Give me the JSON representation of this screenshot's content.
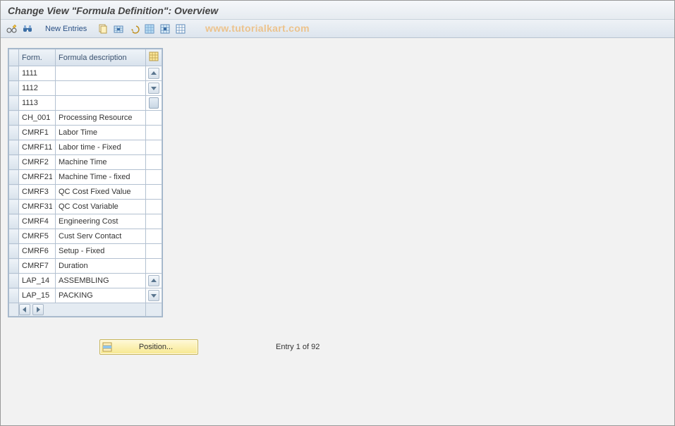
{
  "title": "Change View \"Formula Definition\": Overview",
  "watermark": "www.tutorialkart.com",
  "toolbar": {
    "new_entries_label": "New Entries"
  },
  "grid": {
    "headers": {
      "form": "Form.",
      "desc": "Formula description"
    },
    "rows": [
      {
        "form": "1111",
        "desc": ""
      },
      {
        "form": "1112",
        "desc": ""
      },
      {
        "form": "1113",
        "desc": ""
      },
      {
        "form": "CH_001",
        "desc": "Processing Resource"
      },
      {
        "form": "CMRF1",
        "desc": "Labor Time"
      },
      {
        "form": "CMRF11",
        "desc": "Labor time - Fixed"
      },
      {
        "form": "CMRF2",
        "desc": "Machine Time"
      },
      {
        "form": "CMRF21",
        "desc": "Machine Time - fixed"
      },
      {
        "form": "CMRF3",
        "desc": "QC Cost Fixed Value"
      },
      {
        "form": "CMRF31",
        "desc": "QC Cost Variable"
      },
      {
        "form": "CMRF4",
        "desc": "Engineering Cost"
      },
      {
        "form": "CMRF5",
        "desc": "Cust Serv Contact"
      },
      {
        "form": "CMRF6",
        "desc": "Setup - Fixed"
      },
      {
        "form": "CMRF7",
        "desc": "Duration"
      },
      {
        "form": "LAP_14",
        "desc": "ASSEMBLING"
      },
      {
        "form": "LAP_15",
        "desc": "PACKING"
      }
    ]
  },
  "position": {
    "button_label": "Position...",
    "entry_text": "Entry 1 of 92"
  }
}
